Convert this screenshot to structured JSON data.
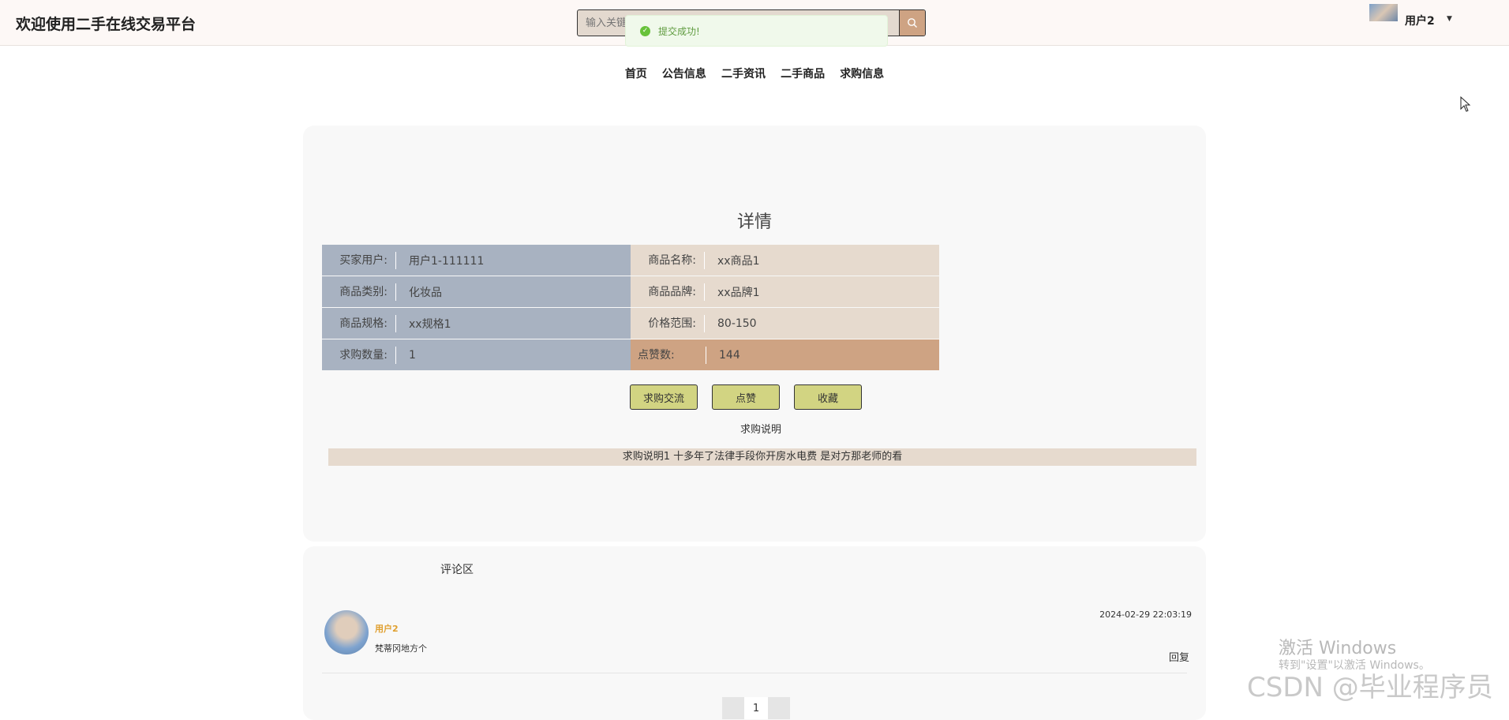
{
  "header": {
    "site_title": "欢迎使用二手在线交易平台",
    "search_placeholder": "输入关键",
    "search_icon": "search-icon",
    "user_name": "用户2"
  },
  "toast": {
    "message": "提交成功!",
    "icon": "check-circle-icon",
    "color": "#67c23a"
  },
  "nav": {
    "items": [
      "首页",
      "公告信息",
      "二手资讯",
      "二手商品",
      "求购信息"
    ]
  },
  "detail": {
    "title": "详情",
    "rows": [
      {
        "left_label": "买家用户:",
        "left_value": "用户1-111111",
        "right_label": "商品名称:",
        "right_value": "xx商品1"
      },
      {
        "left_label": "商品类别:",
        "left_value": "化妆品",
        "right_label": "商品品牌:",
        "right_value": "xx品牌1"
      },
      {
        "left_label": "商品规格:",
        "left_value": "xx规格1",
        "right_label": "价格范围:",
        "right_value": "80-150"
      },
      {
        "left_label": "求购数量:",
        "left_value": "1",
        "right_label": "点赞数:",
        "right_value": "144"
      }
    ],
    "buttons": {
      "exchange": "求购交流",
      "like": "点赞",
      "favorite": "收藏"
    },
    "description_label": "求购说明",
    "description_text": "求购说明1 十多年了法律手段你开房水电费 是对方那老师的看"
  },
  "comments": {
    "heading": "评论区",
    "items": [
      {
        "user": "用户2",
        "text": "梵蒂冈地方个",
        "time": "2024-02-29 22:03:19",
        "reply_label": "回复"
      }
    ],
    "current_page": "1"
  },
  "watermarks": {
    "activate_title": "激活 Windows",
    "activate_sub": "转到\"设置\"以激活 Windows。",
    "csdn": "CSDN @毕业程序员"
  },
  "colors": {
    "topbar_bg": "#fdf8f6",
    "left_cell": "#a8b2c1",
    "right_cell": "#e6dace",
    "highlight_cell": "#cea383",
    "button_bg": "#d2d482"
  }
}
